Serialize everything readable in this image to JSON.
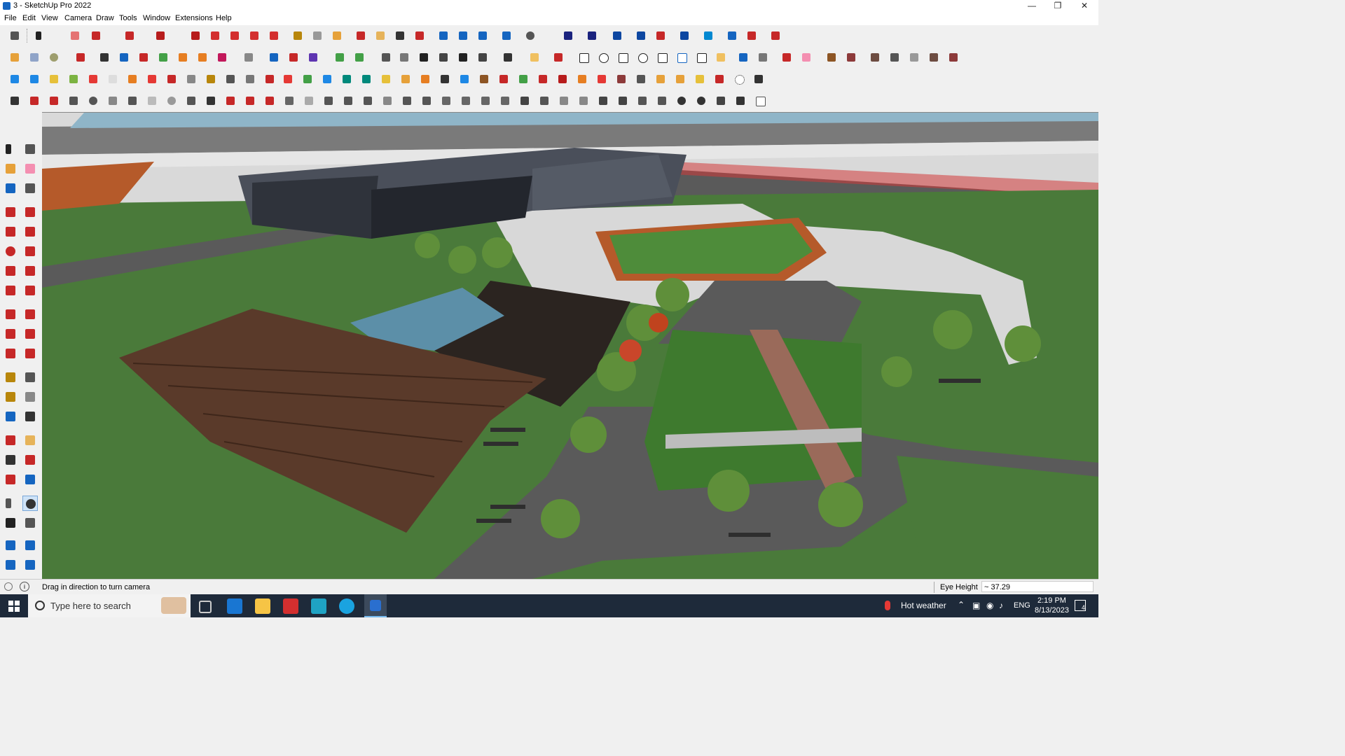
{
  "window": {
    "title": "3 - SketchUp Pro 2022"
  },
  "menu": [
    "File",
    "Edit",
    "View",
    "Camera",
    "Draw",
    "Tools",
    "Window",
    "Extensions",
    "Help"
  ],
  "status": {
    "hint": "Drag in direction to turn camera",
    "measure_label": "Eye Height",
    "measure_value": "~ 37.29"
  },
  "taskbar": {
    "search_placeholder": "Type here to search",
    "weather": "Hot weather",
    "language": "ENG",
    "time": "2:19 PM",
    "date": "8/13/2023",
    "notifications": "4"
  },
  "colors": {
    "accent": "#1565c0",
    "grass": "#4a7a3a",
    "deck": "#5a3a2a"
  }
}
